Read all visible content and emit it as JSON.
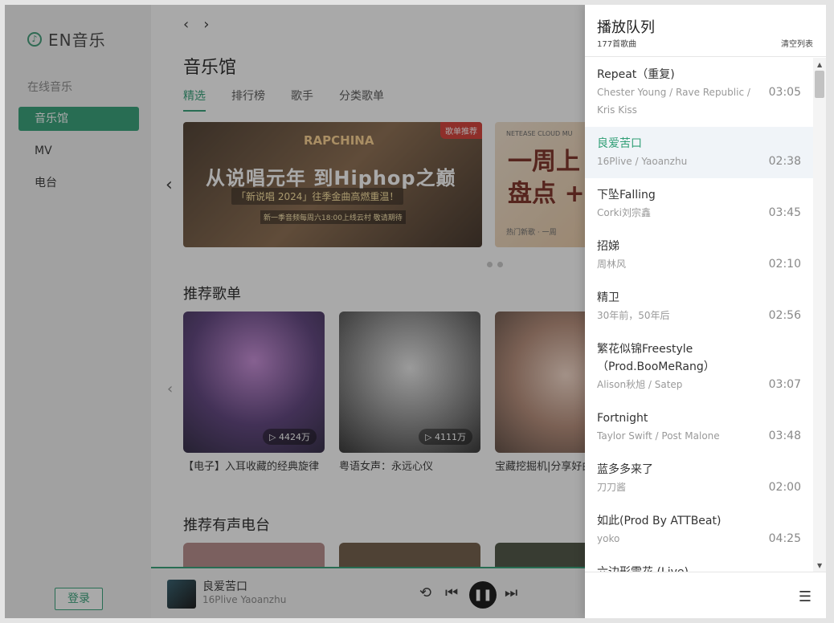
{
  "app": {
    "name": "EN音乐"
  },
  "sidebar": {
    "section": "在线音乐",
    "items": [
      {
        "label": "音乐馆",
        "active": true
      },
      {
        "label": "MV",
        "active": false
      },
      {
        "label": "电台",
        "active": false
      }
    ],
    "login": "登录"
  },
  "main": {
    "title": "音乐馆",
    "tabs": [
      "精选",
      "排行榜",
      "歌手",
      "分类歌单"
    ],
    "banners": [
      {
        "headline": "从说唱元年 到Hiphop之巅",
        "subtitle": "「新说唱 2024」往季金曲高燃重温！",
        "header": "RAPCHINA",
        "note": "新一季音频每周六18:00上线云村 敬请期待",
        "badge": "歌单推荐"
      },
      {
        "brand": "NETEASE CLOUD MU",
        "headline": "一周上\n盘点 +",
        "footer": "热门新歌 · 一周"
      }
    ],
    "recommend_title": "推荐歌单",
    "playlists": [
      {
        "title": "【电子】入耳收藏的经典旋律",
        "plays": "4424万"
      },
      {
        "title": "粤语女声：永远心仪",
        "plays": "4111万"
      },
      {
        "title": "宝藏挖掘机|分享好曲",
        "plays": ""
      }
    ],
    "radio_title": "推荐有声电台"
  },
  "player": {
    "title": "良爱苦口",
    "artist": "16Plive  Yaoanzhu"
  },
  "queue": {
    "title": "播放队列",
    "count": "177首歌曲",
    "clear": "清空列表",
    "items": [
      {
        "name": "Repeat（重复)",
        "artist": "Chester Young / Rave Republic / Kris Kiss",
        "duration": "03:05"
      },
      {
        "name": "良爱苦口",
        "artist": "16Plive / Yaoanzhu",
        "duration": "02:38",
        "playing": true
      },
      {
        "name": "下坠Falling",
        "artist": "Corki刘宗鑫",
        "duration": "03:45"
      },
      {
        "name": "招娣",
        "artist": "周林风",
        "duration": "02:10"
      },
      {
        "name": "精卫",
        "artist": "30年前，50年后",
        "duration": "02:56"
      },
      {
        "name": "繁花似锦Freestyle （Prod.BooMeRang）",
        "artist": "Alison秋旭 / Satep",
        "duration": "03:07"
      },
      {
        "name": "Fortnight",
        "artist": "Taylor Swift / Post Malone",
        "duration": "03:48"
      },
      {
        "name": "蓝多多来了",
        "artist": "刀刀酱",
        "duration": "02:00"
      },
      {
        "name": "如此(Prod By ATTBeat)",
        "artist": "yoko",
        "duration": "04:25"
      },
      {
        "name": "六边形雪花 (Live)",
        "artist": "",
        "duration": ""
      }
    ]
  },
  "colors": {
    "accent": "#2f9e75",
    "badge": "#d33a32"
  },
  "icons": {
    "logo": "music-note-icon",
    "back": "chevron-left-icon",
    "forward": "chevron-right-icon",
    "loop": "repeat-icon",
    "prev": "skip-previous-icon",
    "pause": "pause-icon",
    "next": "skip-next-icon",
    "list": "list-icon"
  }
}
